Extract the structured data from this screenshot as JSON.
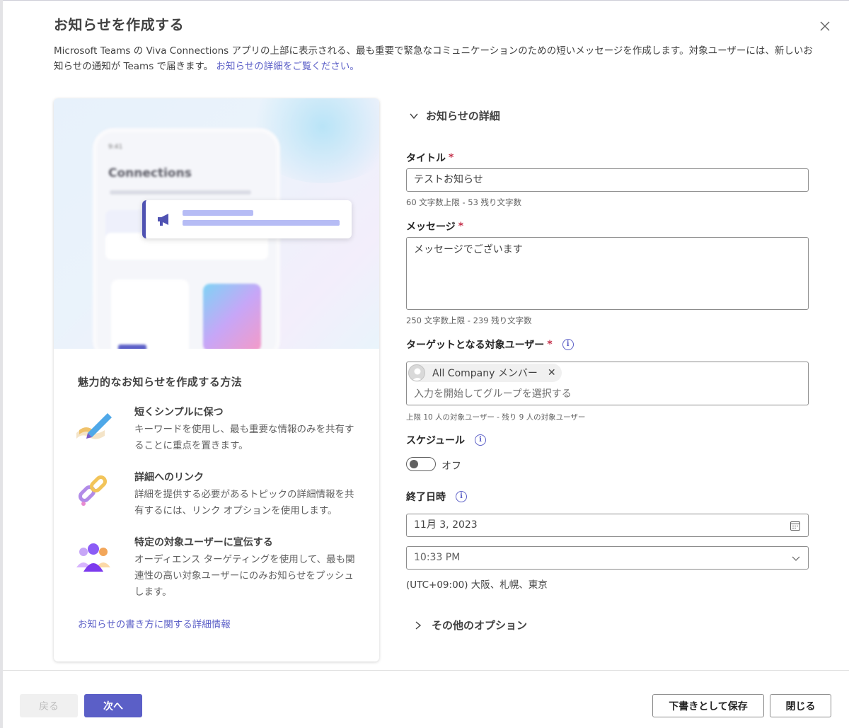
{
  "dialog": {
    "title": "お知らせを作成する",
    "description": "Microsoft Teams の Viva Connections アプリの上部に表示される、最も重要で緊急なコミュニケーションのための短いメッセージを作成します。対象ユーザーには、新しいお知らせの通知が Teams で届きます。",
    "description_link": "お知らせの詳細をご覧ください。"
  },
  "preview": {
    "phone_app_name": "Connections"
  },
  "tips": {
    "title": "魅力的なお知らせを作成する方法",
    "items": [
      {
        "heading": "短くシンプルに保つ",
        "body": "キーワードを使用し、最も重要な情報のみを共有することに重点を置きます。",
        "icon": "pen-icon"
      },
      {
        "heading": "詳細へのリンク",
        "body": "詳細を提供する必要があるトピックの詳細情報を共有するには、リンク オプションを使用します。",
        "icon": "link-icon"
      },
      {
        "heading": "特定の対象ユーザーに宣伝する",
        "body": "オーディエンス ターゲティングを使用して、最も関連性の高い対象ユーザーにのみお知らせをプッシュします。",
        "icon": "people-icon"
      }
    ],
    "link": "お知らせの書き方に関する詳細情報"
  },
  "form": {
    "section_title": "お知らせの詳細",
    "title_label": "タイトル",
    "title_value": "テストお知らせ",
    "title_hint": "60 文字数上限 - 53 残り文字数",
    "message_label": "メッセージ",
    "message_value": "メッセージでございます",
    "message_hint": "250 文字数上限 - 239 残り文字数",
    "audience_label": "ターゲットとなる対象ユーザー",
    "audience_chip": "All Company メンバー",
    "audience_placeholder": "入力を開始してグループを選択する",
    "audience_hint": "上限 10 人の対象ユーザー - 残り 9 人の対象ユーザー",
    "schedule_label": "スケジュール",
    "schedule_state": "オフ",
    "end_label": "終了日時",
    "end_date": "11月 3, 2023",
    "end_time": "10:33 PM",
    "timezone": "(UTC+09:00) 大阪、札幌、東京",
    "more_options": "その他のオプション",
    "required_mark": "*"
  },
  "footer": {
    "back": "戻る",
    "next": "次へ",
    "save_draft": "下書きとして保存",
    "close": "閉じる"
  },
  "colors": {
    "accent": "#5b5fc7",
    "required": "#c4314b"
  }
}
